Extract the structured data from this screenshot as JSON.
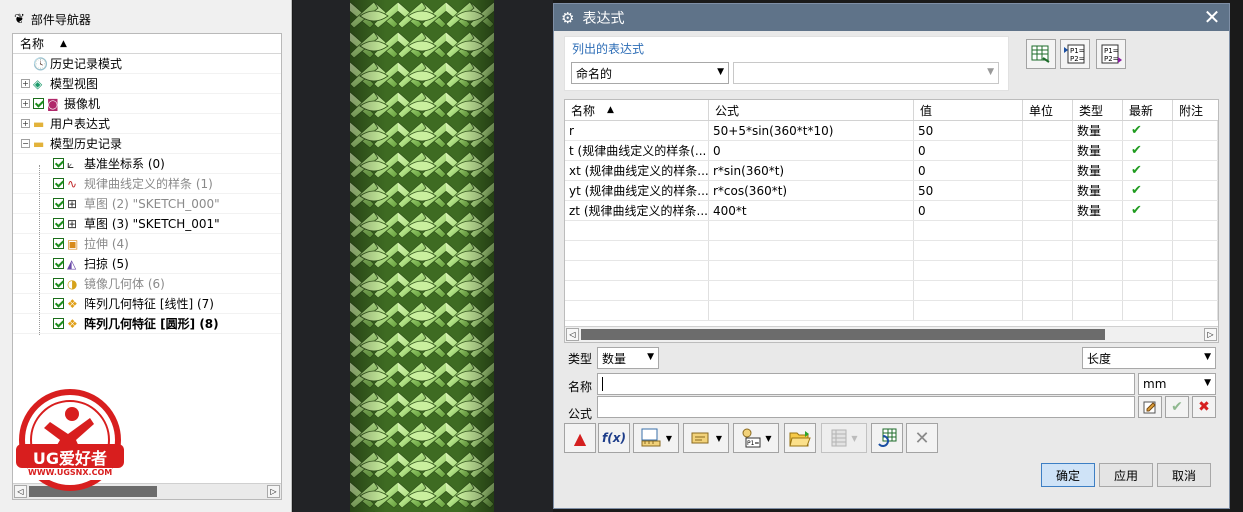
{
  "navigator": {
    "title": "部件导航器",
    "column_name": "名称",
    "items": [
      {
        "label": "历史记录模式",
        "level": 0,
        "icon": "clock-icon",
        "expander": "",
        "check": false,
        "state": "normal"
      },
      {
        "label": "模型视图",
        "level": 0,
        "icon": "model-view-icon",
        "expander": "+",
        "check": false,
        "state": "normal"
      },
      {
        "label": "摄像机",
        "level": 0,
        "icon": "camera-icon",
        "expander": "+",
        "check": true,
        "state": "normal"
      },
      {
        "label": "用户表达式",
        "level": 0,
        "icon": "folder-icon",
        "expander": "+",
        "check": false,
        "state": "normal"
      },
      {
        "label": "模型历史记录",
        "level": 0,
        "icon": "folder-open-icon",
        "expander": "−",
        "check": false,
        "state": "normal"
      },
      {
        "label": "基准坐标系 (0)",
        "level": 1,
        "icon": "datum-csys-icon",
        "check": true,
        "state": "normal"
      },
      {
        "label": "规律曲线定义的样条 (1)",
        "level": 1,
        "icon": "law-curve-icon",
        "check": true,
        "state": "grey"
      },
      {
        "label": "草图 (2) \"SKETCH_000\"",
        "level": 1,
        "icon": "sketch-icon",
        "check": true,
        "state": "grey"
      },
      {
        "label": "草图 (3) \"SKETCH_001\"",
        "level": 1,
        "icon": "sketch-icon",
        "check": true,
        "state": "normal"
      },
      {
        "label": "拉伸 (4)",
        "level": 1,
        "icon": "extrude-icon",
        "check": true,
        "state": "grey"
      },
      {
        "label": "扫掠 (5)",
        "level": 1,
        "icon": "sweep-icon",
        "check": true,
        "state": "normal"
      },
      {
        "label": "镜像几何体 (6)",
        "level": 1,
        "icon": "mirror-body-icon",
        "check": true,
        "state": "grey"
      },
      {
        "label": "阵列几何特征 [线性] (7)",
        "level": 1,
        "icon": "pattern-icon",
        "check": true,
        "state": "normal"
      },
      {
        "label": "阵列几何特征 [圆形] (8)",
        "level": 1,
        "icon": "pattern-icon",
        "check": true,
        "state": "bold"
      }
    ]
  },
  "watermark": {
    "brand": "UG爱好者",
    "url": "WWW.UGSNX.COM"
  },
  "dialog": {
    "title": "表达式",
    "list_title": "列出的表达式",
    "list_filter": "命名的",
    "list_filter_value": "",
    "columns": [
      "名称",
      "公式",
      "值",
      "单位",
      "类型",
      "最新",
      "附注"
    ],
    "rows": [
      {
        "name": "r",
        "formula": "50+5*sin(360*t*10)",
        "value": "50",
        "unit": "",
        "type": "数量",
        "latest": true,
        "note": ""
      },
      {
        "name": "t (规律曲线定义的样条(...",
        "formula": "0",
        "value": "0",
        "unit": "",
        "type": "数量",
        "latest": true,
        "note": ""
      },
      {
        "name": "xt (规律曲线定义的样条...",
        "formula": "r*sin(360*t)",
        "value": "0",
        "unit": "",
        "type": "数量",
        "latest": true,
        "note": ""
      },
      {
        "name": "yt (规律曲线定义的样条...",
        "formula": "r*cos(360*t)",
        "value": "50",
        "unit": "",
        "type": "数量",
        "latest": true,
        "note": ""
      },
      {
        "name": "zt (规律曲线定义的样条...",
        "formula": "400*t",
        "value": "0",
        "unit": "",
        "type": "数量",
        "latest": true,
        "note": ""
      }
    ],
    "type_label": "类型",
    "type_value": "数量",
    "dimension_value": "长度",
    "name_label": "名称",
    "name_value": "",
    "unit_value": "mm",
    "formula_label": "公式",
    "formula_value": "",
    "ok_label": "确定",
    "apply_label": "应用",
    "cancel_label": "取消",
    "accent_color": "#5f7389"
  }
}
